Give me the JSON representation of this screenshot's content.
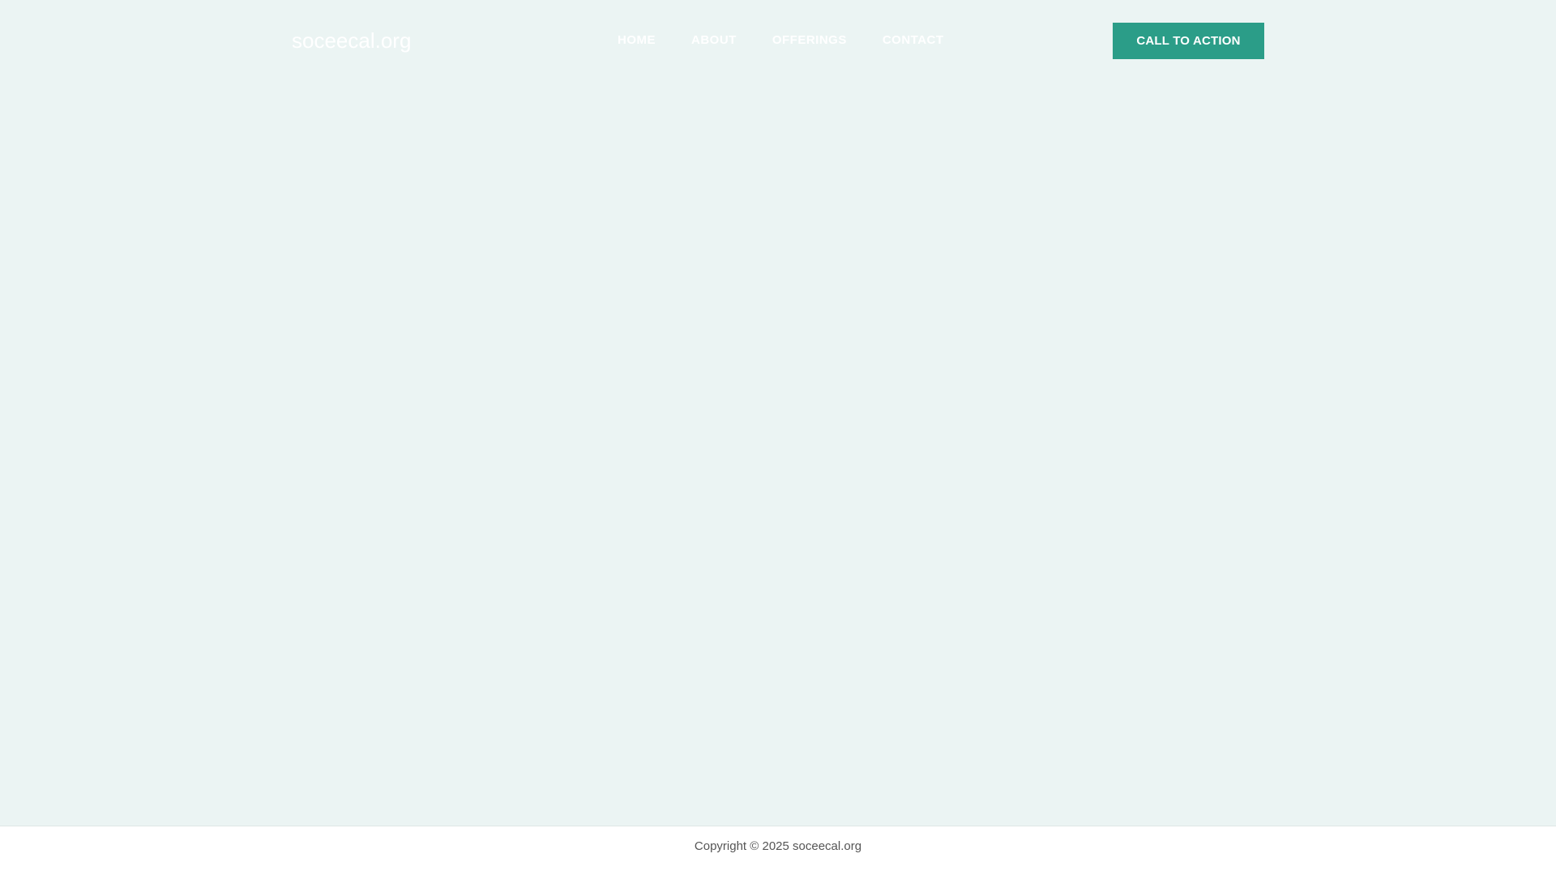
{
  "header": {
    "brand": "soceecal.org",
    "nav": [
      {
        "label": "HOME"
      },
      {
        "label": "ABOUT"
      },
      {
        "label": "OFFERINGS"
      },
      {
        "label": "CONTACT"
      }
    ],
    "cta_label": "CALL TO ACTION"
  },
  "footer": {
    "copyright": "Copyright © 2025 soceecal.org"
  },
  "colors": {
    "background": "#ebf4f3",
    "accent": "#2b9d88",
    "footer_background": "#ffffff",
    "footer_text": "#555555"
  }
}
